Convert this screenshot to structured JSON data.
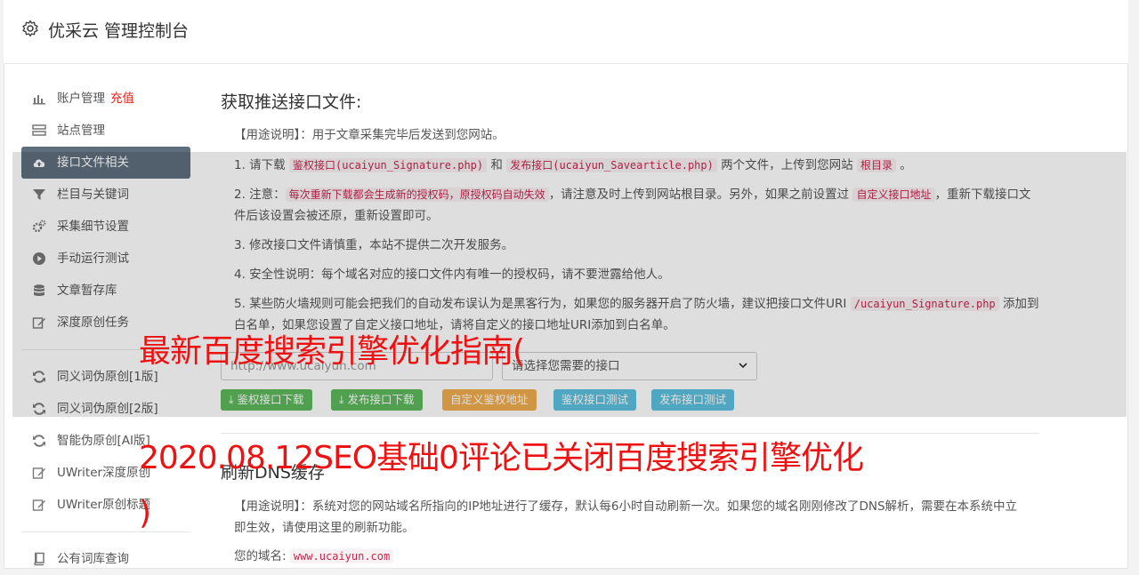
{
  "header": {
    "title": "优采云 管理控制台"
  },
  "sidebar": {
    "items": [
      {
        "label": "账户管理",
        "icon": "bar-chart-icon"
      },
      {
        "label": "站点管理",
        "icon": "server-icon"
      },
      {
        "label": "接口文件相关",
        "icon": "cloud-upload-icon"
      },
      {
        "label": "栏目与关键词",
        "icon": "filter-icon"
      },
      {
        "label": "采集细节设置",
        "icon": "cogs-icon"
      },
      {
        "label": "手动运行测试",
        "icon": "play-circle-icon"
      },
      {
        "label": "文章暂存库",
        "icon": "database-icon"
      },
      {
        "label": "深度原创任务",
        "icon": "edit-icon"
      }
    ],
    "recharge_label": "充值",
    "items2": [
      {
        "label": "同义词伪原创[1版]",
        "icon": "refresh-icon"
      },
      {
        "label": "同义词伪原创[2版]",
        "icon": "refresh-icon"
      },
      {
        "label": "智能伪原创[AI版]",
        "icon": "refresh-icon"
      },
      {
        "label": "UWriter深度原创",
        "icon": "edit-icon"
      },
      {
        "label": "UWriter原创标题",
        "icon": "edit-icon"
      }
    ],
    "items3": [
      {
        "label": "公有词库查询",
        "icon": "book-icon"
      }
    ]
  },
  "main": {
    "section1_title": "获取推送接口文件:",
    "usage1": "【用途说明】：用于文章采集完毕后发送到您网站。",
    "step1_a": "1. 请下载 ",
    "step1_code1": "鉴权接口(ucaiyun_Signature.php)",
    "step1_b": " 和 ",
    "step1_code2": "发布接口(ucaiyun_Savearticle.php)",
    "step1_c": " 两个文件，上传到您网站 ",
    "step1_code3": "根目录",
    "step1_d": " 。",
    "step2_a": "2. 注意：",
    "step2_code1": "每次重新下载都会生成新的授权码，原授权码自动失效",
    "step2_b": "，请注意及时上传到网站根目录。另外，如果之前设置过 ",
    "step2_code2": "自定义接口地址",
    "step2_c": "，重新下载接口文件后该设置会被还原，重新设置即可。",
    "step3": "3. 修改接口文件请慎重，本站不提供二次开发服务。",
    "step4": "4. 安全性说明：每个域名对应的接口文件内有唯一的授权码，请不要泄露给他人。",
    "step5_a": "5. 某些防火墙规则可能会把我们的自动发布误认为是黑客行为，如果您的服务器开启了防火墙，建议把接口文件URI ",
    "step5_code": "/ucaiyun_Signature.php",
    "step5_b": " 添加到白名单，如果您设置了自定义接口地址，请将自定义的接口地址URI添加到白名单。",
    "url_input_placeholder": "http://www.ucaiyun.com",
    "interface_select": "请选择您需要的接口",
    "buttons": {
      "download_auth": "鉴权接口下载",
      "download_publish": "发布接口下载",
      "custom_auth": "自定义鉴权地址",
      "test_auth": "鉴权接口测试",
      "test_publish": "发布接口测试"
    },
    "section2_title": "刷新DNS缓存",
    "usage2": "【用途说明】：系统对您的网站域名所指向的IP地址进行了缓存，默认每6小时自动刷新一次。如果您的域名刚刚修改了DNS解析，需要在本系统中立即生效，请使用这里的刷新功能。",
    "domain_label": "您的域名:",
    "domain_value": "www.ucaiyun.com"
  },
  "overlay": {
    "headline1": "最新百度搜索引擎优化指南(",
    "headline2": "2020.08.12SEO基础0评论已关闭百度搜索引擎优化",
    "headline3": ")"
  },
  "colors": {
    "active_nav": "#5f6e7c",
    "accent_red": "#ee1111",
    "btn_green": "#5cb85c",
    "btn_orange": "#f0ad4e",
    "btn_blue": "#5bc0de"
  }
}
